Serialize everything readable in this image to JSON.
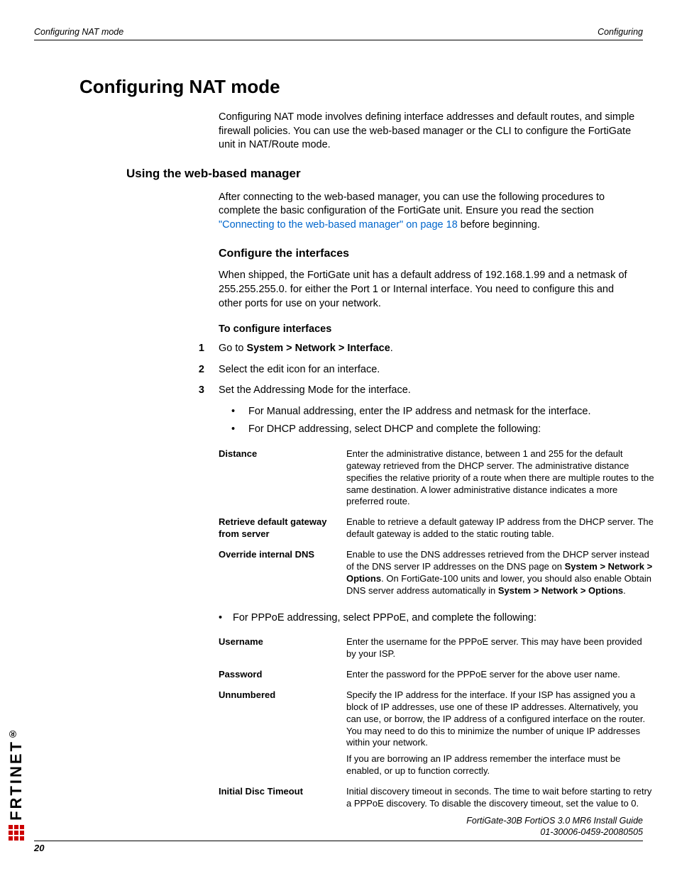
{
  "header": {
    "left": "Configuring NAT mode",
    "right": "Configuring"
  },
  "h1": "Configuring NAT mode",
  "intro": "Configuring NAT mode involves defining interface addresses and default routes, and simple firewall policies. You can use the web-based manager or the CLI to configure the FortiGate unit in NAT/Route mode.",
  "h2": "Using the web-based manager",
  "p2a": "After connecting to the web-based manager, you can use the following procedures to complete the basic configuration of the FortiGate unit. Ensure you read the section ",
  "p2link": "\"Connecting to the web-based manager\" on page 18",
  "p2b": " before beginning.",
  "h3": "Configure the interfaces",
  "p3": "When shipped, the FortiGate unit has a default address of 192.168.1.99 and a netmask of 255.255.255.0. for either the Port 1 or Internal interface. You need to configure this and other ports for use on your network.",
  "h4": "To configure interfaces",
  "steps": {
    "s1a": "Go to ",
    "s1b": "System > Network > Interface",
    "s1c": ".",
    "s2": "Select the edit icon for an interface.",
    "s3": "Set the Addressing Mode for the interface."
  },
  "bullets1": {
    "b1": "For Manual addressing, enter the IP address and netmask for the interface.",
    "b2": "For DHCP addressing, select DHCP and complete the following:"
  },
  "dhcp_table": {
    "r1t": "Distance",
    "r1d": "Enter the administrative distance, between 1 and 255 for the default gateway retrieved from the DHCP server. The administrative distance specifies the relative priority of a route when there are multiple routes to the same destination. A lower administrative distance indicates a more preferred route.",
    "r2t": "Retrieve default gateway from server",
    "r2d": "Enable to retrieve a default gateway IP address from the DHCP server. The default gateway is added to the static routing table.",
    "r3t": "Override internal DNS",
    "r3d_a": "Enable to use the DNS addresses retrieved from the DHCP server instead of the DNS server IP addresses on the DNS page on ",
    "r3d_b": "System > Network > Options",
    "r3d_c": ". On FortiGate-100 units and lower, you should also enable Obtain DNS server address automatically in ",
    "r3d_d": "System > Network > Options",
    "r3d_e": "."
  },
  "bullet_pppoe": "For PPPoE addressing, select PPPoE, and complete the following:",
  "pppoe_table": {
    "r1t": "Username",
    "r1d": "Enter the username for the PPPoE server. This may have been provided by your ISP.",
    "r2t": "Password",
    "r2d": "Enter the password for the PPPoE server for the above user name.",
    "r3t": "Unnumbered",
    "r3d1": "Specify the IP address for the interface. If your ISP has assigned you a block of IP addresses, use one of these IP addresses. Alternatively, you can use, or borrow, the IP address of a configured interface on the router. You may need to do this to minimize the number of unique IP addresses within your network.",
    "r3d2": "If you are borrowing an IP address remember the interface must be enabled, or up to function correctly.",
    "r4t": "Initial Disc Timeout",
    "r4d": "Initial discovery timeout in seconds. The time to wait before starting to retry a PPPoE discovery. To disable the discovery timeout, set the value to 0."
  },
  "footer": {
    "line1": "FortiGate-30B FortiOS 3.0 MR6 Install Guide",
    "line2": "01-30006-0459-20080505",
    "page": "20"
  },
  "logo_text": "FORTINET"
}
